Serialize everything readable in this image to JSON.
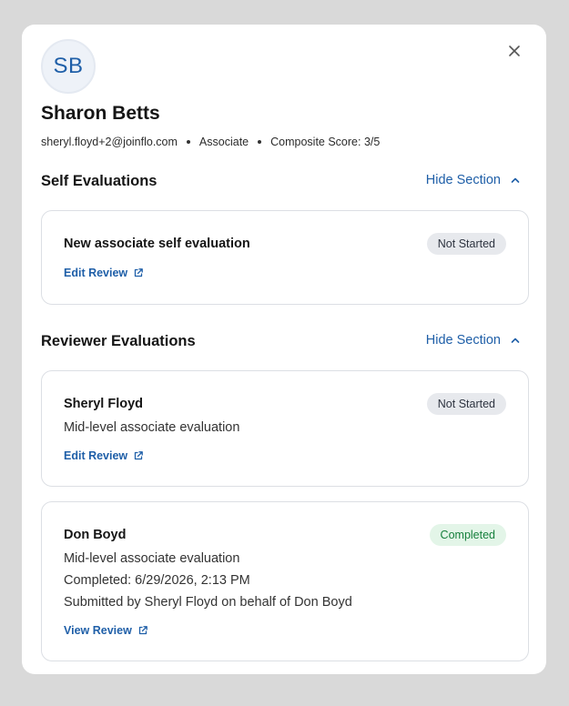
{
  "profile": {
    "initials": "SB",
    "name": "Sharon Betts",
    "email": "sheryl.floyd+2@joinflo.com",
    "role": "Associate",
    "composite": "Composite Score: 3/5"
  },
  "self_section": {
    "title": "Self Evaluations",
    "toggle_label": "Hide Section",
    "cards": [
      {
        "title": "New associate self evaluation",
        "status": "Not Started",
        "link": "Edit Review"
      }
    ]
  },
  "reviewer_section": {
    "title": "Reviewer Evaluations",
    "toggle_label": "Hide Section",
    "cards": [
      {
        "title": "Sheryl Floyd",
        "status": "Not Started",
        "subtitle": "Mid-level associate evaluation",
        "link": "Edit Review"
      },
      {
        "title": "Don Boyd",
        "status": "Completed",
        "subtitle": "Mid-level associate evaluation",
        "completed": "Completed: 6/29/2026, 2:13 PM",
        "submitted": "Submitted by Sheryl Floyd on behalf of Don Boyd",
        "link": "View Review"
      }
    ]
  },
  "colors": {
    "accent": "#1f5fa8",
    "badge_gray": "#e7e9ed",
    "badge_green_bg": "#e3f5e8",
    "badge_green_text": "#17803d"
  },
  "icons": {
    "close": "close-icon",
    "chevron": "chevron-up-icon",
    "external": "external-link-icon"
  }
}
